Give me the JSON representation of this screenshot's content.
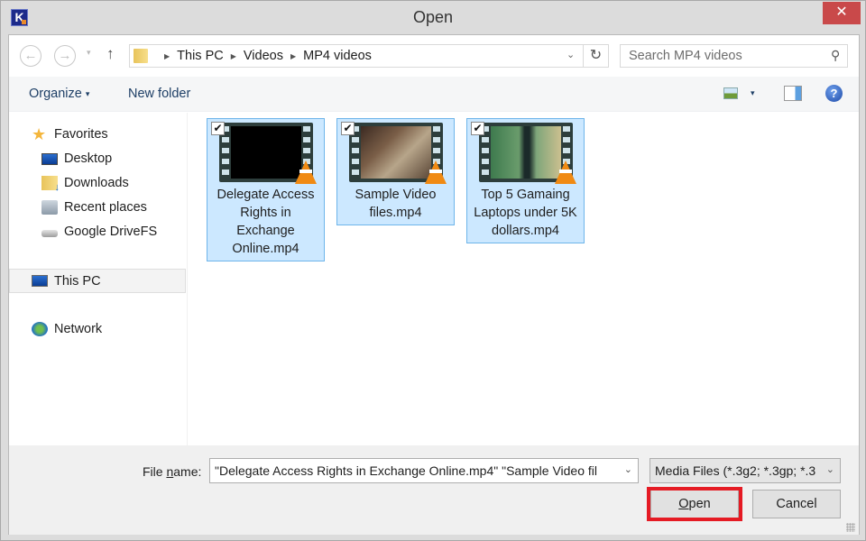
{
  "window": {
    "title": "Open",
    "app_icon_letter": "K",
    "close_glyph": "✕"
  },
  "navigation": {
    "back_glyph": "←",
    "forward_glyph": "→",
    "recent_dropdown_glyph": "▾",
    "up_glyph": "↑",
    "breadcrumbs": [
      "This PC",
      "Videos",
      "MP4 videos"
    ],
    "breadcrumb_separator": "▶",
    "address_dropdown_glyph": "⌄",
    "refresh_glyph": "↻",
    "search_placeholder": "Search MP4 videos",
    "search_glyph": "⚲"
  },
  "toolbar": {
    "organize_label": "Organize",
    "organize_caret": "▾",
    "new_folder_label": "New folder",
    "view_dropdown_glyph": "▾",
    "help_glyph": "?"
  },
  "sidebar": {
    "favorites_label": "Favorites",
    "favorites": [
      {
        "label": "Desktop",
        "icon": "desktop-icon"
      },
      {
        "label": "Downloads",
        "icon": "downloads-icon"
      },
      {
        "label": "Recent places",
        "icon": "recent-places-icon"
      },
      {
        "label": "Google DriveFS",
        "icon": "drive-icon"
      }
    ],
    "this_pc_label": "This PC",
    "network_label": "Network",
    "selected": "This PC"
  },
  "files": [
    {
      "name": "Delegate Access Rights in Exchange Online.mp4",
      "display_lines": "Delegate Access Rights in Exchange Online.mp4",
      "checked": true,
      "selected": true
    },
    {
      "name": "Sample Video files.mp4",
      "display_lines": "Sample Video files.mp4",
      "checked": true,
      "selected": true
    },
    {
      "name": "Top 5 Gamaing Laptops under 5K dollars.mp4",
      "display_lines": "Top 5 Gamaing Laptops under 5K dollars.mp4",
      "checked": true,
      "selected": true
    }
  ],
  "checkbox_glyph": "✔",
  "footer": {
    "file_name_label_pre": "File ",
    "file_name_label_mnemonic": "n",
    "file_name_label_post": "ame:",
    "file_name_value": "\"Delegate Access Rights in Exchange Online.mp4\" \"Sample Video fil",
    "file_type_value": "Media Files (*.3g2; *.3gp; *.3",
    "dropdown_glyph": "⌄",
    "open_mnemonic": "O",
    "open_rest": "pen",
    "cancel_label": "Cancel",
    "highlight_color": "#e51b24"
  }
}
